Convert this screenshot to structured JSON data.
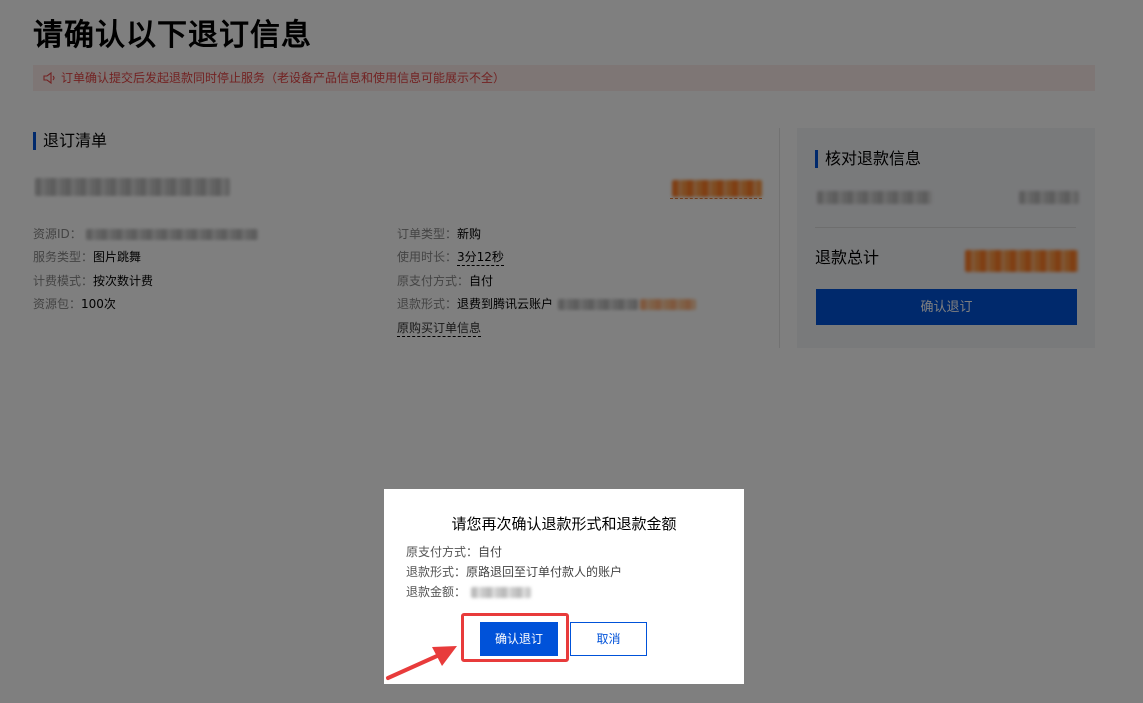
{
  "page": {
    "title": "请确认以下退订信息",
    "notice": "订单确认提交后发起退款同时停止服务（老设备产品信息和使用信息可能展示不全）"
  },
  "refund_list": {
    "heading": "退订清单",
    "left": [
      {
        "key": "资源ID：",
        "value": ""
      },
      {
        "key": "服务类型：",
        "value": "图片跳舞"
      },
      {
        "key": "计费模式：",
        "value": "按次数计费"
      },
      {
        "key": "资源包：",
        "value": "100次"
      }
    ],
    "right": {
      "order_type": {
        "key": "订单类型：",
        "value": "新购"
      },
      "duration": {
        "key": "使用时长：",
        "value": "3分12秒"
      },
      "pay_method": {
        "key": "原支付方式：",
        "value": "自付"
      },
      "refund_form": {
        "key": "退款形式：",
        "value": "退费到腾讯云账户"
      },
      "order_link": "原购买订单信息"
    }
  },
  "summary": {
    "heading": "核对退款信息",
    "total_label": "退款总计",
    "confirm_button": "确认退订"
  },
  "modal": {
    "title": "请您再次确认退款形式和退款金额",
    "pay_method": {
      "key": "原支付方式：",
      "value": "自付"
    },
    "refund_form": {
      "key": "退款形式：",
      "value": "原路退回至订单付款人的账户"
    },
    "refund_amount": {
      "key": "退款金额：",
      "value": ""
    },
    "confirm_button": "确认退订",
    "cancel_button": "取消"
  },
  "colors": {
    "primary": "#0052d9",
    "notice_bg": "#fdecea",
    "notice_text": "#e54545",
    "highlight": "#e83b3b"
  }
}
